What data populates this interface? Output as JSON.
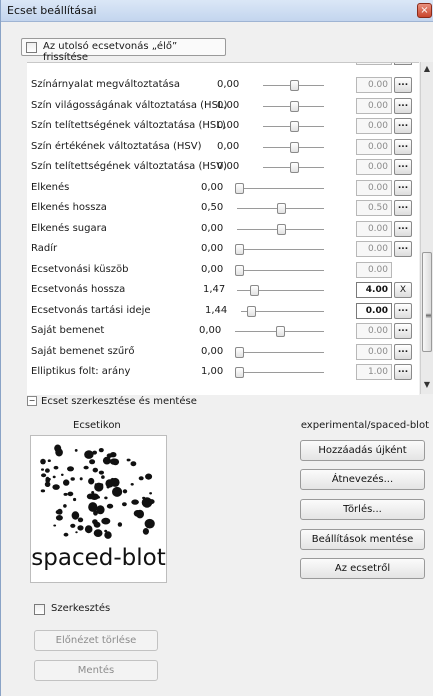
{
  "window": {
    "title": "Ecset beállításai",
    "close_glyph": "×"
  },
  "live_update": {
    "label": "Az utolsó ecsetvonás „élő” frissítése",
    "checked": false
  },
  "params": [
    {
      "name": "Színárnyalat megváltoztatása",
      "value": "0,00",
      "slider": 0.5,
      "spin": "0.00",
      "btn": "..."
    },
    {
      "name": "Szín világosságának változtatása (HSL)",
      "value": "0,00",
      "slider": 0.5,
      "spin": "0.00",
      "btn": "..."
    },
    {
      "name": "Szín telítettségének változtatása (HSL)",
      "value": "0,00",
      "slider": 0.5,
      "spin": "0.00",
      "btn": "..."
    },
    {
      "name": "Szín értékének változtatása (HSV)",
      "value": "0,00",
      "slider": 0.5,
      "spin": "0.00",
      "btn": "..."
    },
    {
      "name": "Szín telítettségének változtatása (HSV)",
      "value": "0,00",
      "slider": 0.5,
      "spin": "0.00",
      "btn": "..."
    },
    {
      "name": "Elkenés",
      "value": "0,00",
      "slider": 0.0,
      "spin": "0.00",
      "btn": "..."
    },
    {
      "name": "Elkenés hossza",
      "value": "0,50",
      "slider": 0.5,
      "spin": "0.50",
      "btn": "..."
    },
    {
      "name": "Elkenés sugara",
      "value": "0,00",
      "slider": 0.5,
      "spin": "0.00",
      "btn": "..."
    },
    {
      "name": "Radír",
      "value": "0,00",
      "slider": 0.0,
      "spin": "0.00",
      "btn": "..."
    },
    {
      "name": "Ecsetvonási küszöb",
      "value": "0,00",
      "slider": 0.0,
      "spin": "0.00",
      "btn": ""
    },
    {
      "name": "Ecsetvonás hossza",
      "value": "1,47",
      "slider": 0.2,
      "spin": "4.00",
      "btn": "X",
      "active": true
    },
    {
      "name": "Ecsetvonás tartási ideje",
      "value": "1,44",
      "slider": 0.12,
      "spin": "0.00",
      "btn": "...",
      "active": true
    },
    {
      "name": "Saját bemenet",
      "value": "0,00",
      "slider": 0.5,
      "spin": "0.00",
      "btn": "..."
    },
    {
      "name": "Saját bemenet szűrő",
      "value": "0,00",
      "slider": 0.0,
      "spin": "0.00",
      "btn": "..."
    },
    {
      "name": "Elliptikus folt: arány",
      "value": "1,00",
      "slider": 0.0,
      "spin": "1.00",
      "btn": "..."
    }
  ],
  "scroll_grip": "≡",
  "section": {
    "toggle": "−",
    "label": "Ecset szerkesztése és mentése"
  },
  "brush_icon": {
    "label": "Ecsetikon",
    "caption": "spaced-blot"
  },
  "edit": {
    "label": "Szerkesztés",
    "checked": false
  },
  "buttons": {
    "clear_preview": "Előnézet törlése",
    "save": "Mentés",
    "add_new": "Hozzáadás újként",
    "rename": "Átnevezés...",
    "delete": "Törlés...",
    "save_settings": "Beállítások mentése",
    "about": "Az ecsetről"
  },
  "brush_name": "experimental/spaced-blot"
}
